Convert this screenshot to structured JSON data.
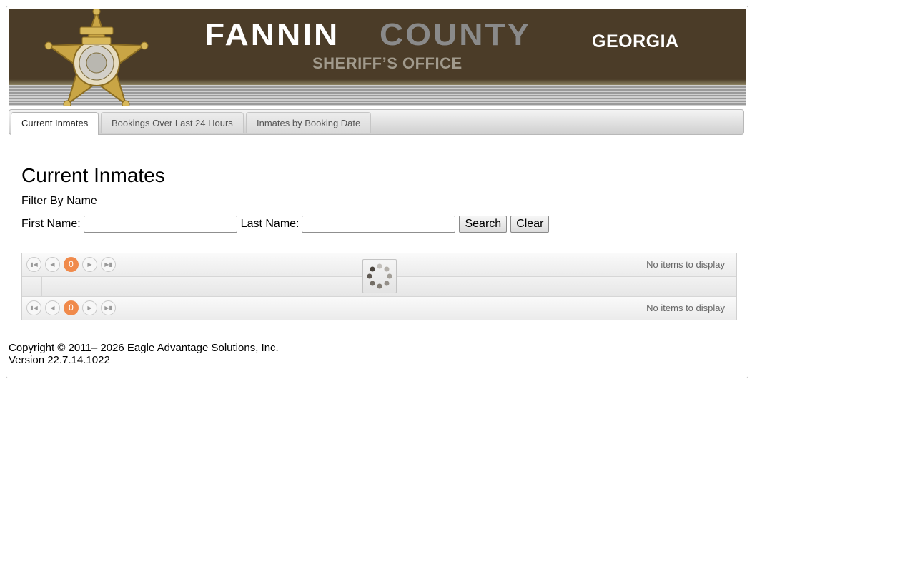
{
  "header": {
    "title_part1": "FANNIN",
    "title_part2": "COUNTY",
    "state": "GEORGIA",
    "subtitle": "SHERIFF’S OFFICE",
    "badge_text": "DEPUTY SHERIFF FANNIN GA. COUNTY GEORGIA SHERIFFS ASSOCIATION"
  },
  "tabs": [
    {
      "label": "Current Inmates",
      "active": true
    },
    {
      "label": "Bookings Over Last 24 Hours",
      "active": false
    },
    {
      "label": "Inmates by Booking Date",
      "active": false
    }
  ],
  "main": {
    "title": "Current Inmates",
    "filter_label": "Filter By Name",
    "first_name_label": "First Name:",
    "first_name_value": "",
    "last_name_label": "Last Name:",
    "last_name_value": "",
    "search_label": "Search",
    "clear_label": "Clear"
  },
  "grid": {
    "current_page": "0",
    "info_top": "No items to display",
    "info_bottom": "No items to display",
    "loading": true
  },
  "footer": {
    "copyright": "Copyright © 2011– 2026 Eagle Advantage Solutions, Inc.",
    "version": "Version 22.7.14.1022"
  },
  "colors": {
    "banner_brown": "#4b3c28",
    "county_gray": "#8a8a8a",
    "pager_accent": "#f08a4b"
  }
}
